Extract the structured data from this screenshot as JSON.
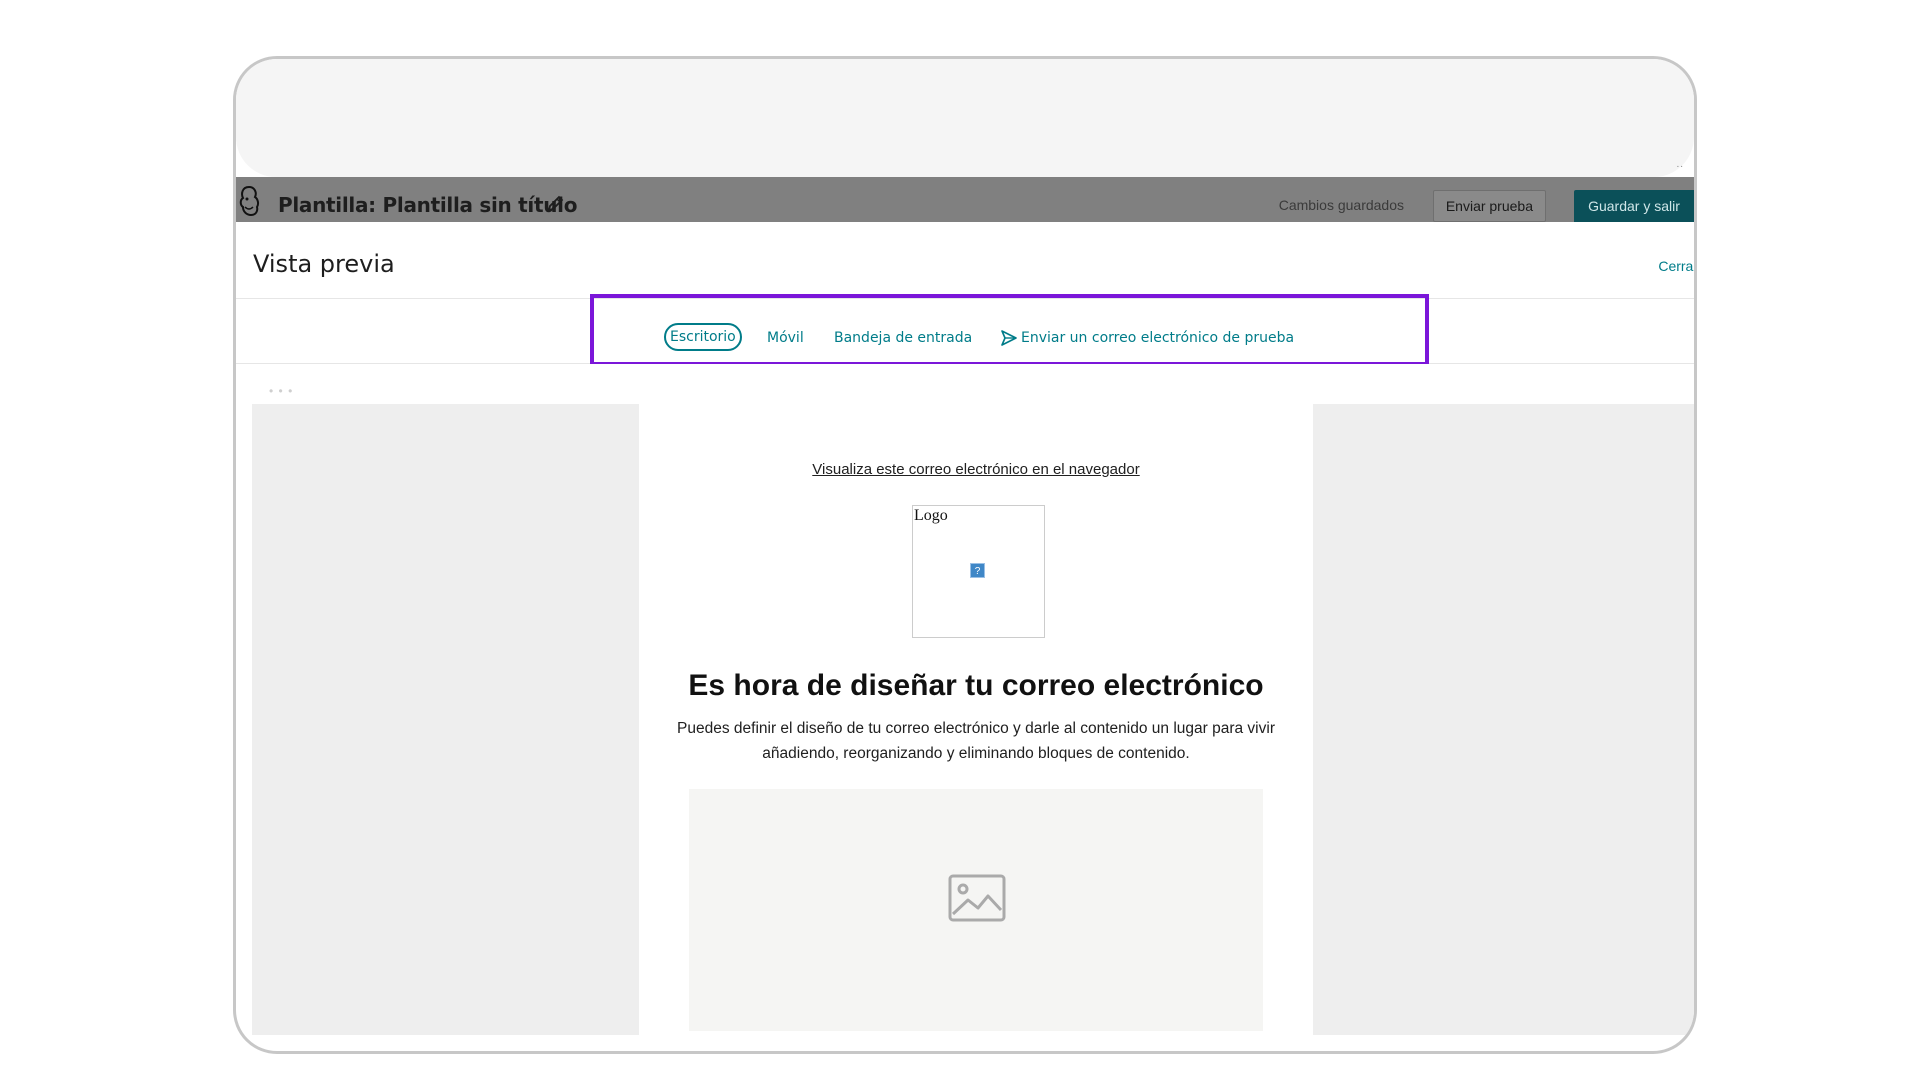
{
  "app_bar": {
    "template_title": "Plantilla: Plantilla sin título",
    "saved_status": "Cambios guardados",
    "send_test_button": "Enviar prueba",
    "save_exit_button": "Guardar y salir"
  },
  "preview": {
    "title": "Vista previa",
    "close_link": "Cerrar"
  },
  "tabs": {
    "desktop": "Escritorio",
    "mobile": "Móvil",
    "inbox": "Bandeja de entrada",
    "send_test_email": "Enviar un correo electrónico de prueba"
  },
  "email": {
    "view_in_browser": "Visualiza este correo electrónico en el navegador",
    "logo_label": "Logo",
    "broken_image_glyph": "?",
    "headline": "Es hora de diseñar tu correo electrónico",
    "body": "Puedes definir el diseño de tu correo electrónico y darle al contenido un lugar para vivir añadiendo, reorganizando y eliminando bloques de contenido."
  },
  "colors": {
    "accent_teal": "#007c89",
    "save_button_bg": "#0b5059",
    "highlight_purple": "#7b16d9"
  },
  "icons": [
    "freddie-logo-icon",
    "pencil-icon",
    "send-icon",
    "image-placeholder-icon"
  ]
}
